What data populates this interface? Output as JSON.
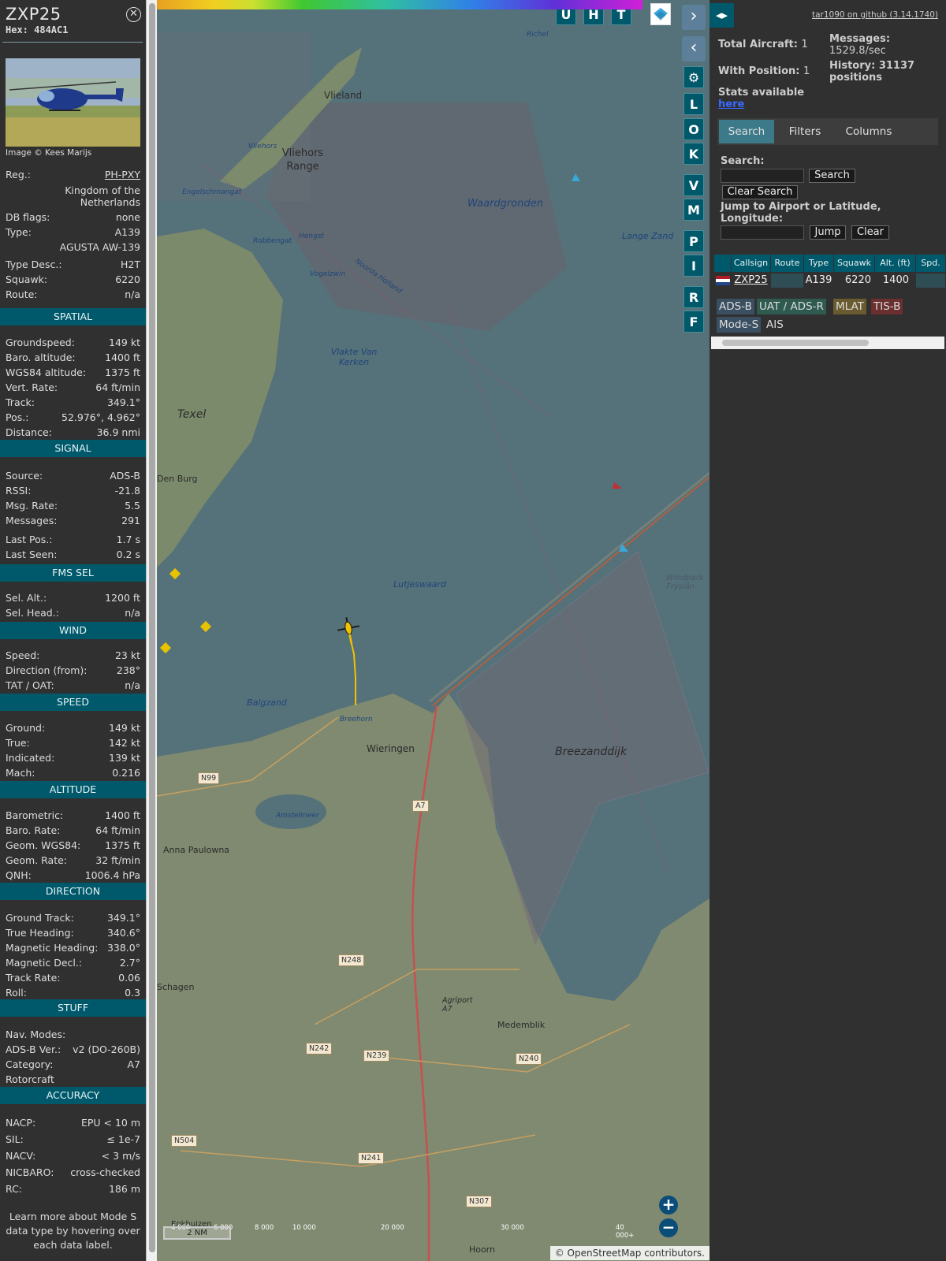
{
  "aircraft": {
    "callsign": "ZXP25",
    "hex": "Hex: 484AC1",
    "photo_credit": "Image © Kees Marijs",
    "reg_label": "Reg.:",
    "reg": "PH-PXY",
    "country": "Kingdom of the Netherlands",
    "dbflags_label": "DB flags:",
    "dbflags": "none",
    "type_label": "Type:",
    "type": "A139",
    "type_name": "AGUSTA AW-139",
    "typedesc_label": "Type Desc.:",
    "typedesc": "H2T",
    "squawk_label": "Squawk:",
    "squawk": "6220",
    "route_label": "Route:",
    "route": "n/a"
  },
  "spatial": {
    "title": "SPATIAL",
    "rows": [
      [
        "Groundspeed:",
        "149 kt"
      ],
      [
        "Baro. altitude:",
        "1400 ft"
      ],
      [
        "WGS84 altitude:",
        "1375 ft"
      ],
      [
        "Vert. Rate:",
        "64 ft/min"
      ],
      [
        "Track:",
        "349.1°"
      ],
      [
        "Pos.:",
        "52.976°, 4.962°"
      ],
      [
        "Distance:",
        "36.9 nmi"
      ]
    ]
  },
  "signal": {
    "title": "SIGNAL",
    "rows": [
      [
        "Source:",
        "ADS-B"
      ],
      [
        "RSSI:",
        "-21.8"
      ],
      [
        "Msg. Rate:",
        "5.5"
      ],
      [
        "Messages:",
        "291"
      ],
      [
        "Last Pos.:",
        "1.7 s"
      ],
      [
        "Last Seen:",
        "0.2 s"
      ]
    ]
  },
  "fms": {
    "title": "FMS SEL",
    "rows": [
      [
        "Sel. Alt.:",
        "1200 ft"
      ],
      [
        "Sel. Head.:",
        "n/a"
      ]
    ]
  },
  "wind": {
    "title": "WIND",
    "rows": [
      [
        "Speed:",
        "23 kt"
      ],
      [
        "Direction (from):",
        "238°"
      ],
      [
        "TAT / OAT:",
        "n/a"
      ]
    ]
  },
  "speed": {
    "title": "SPEED",
    "rows": [
      [
        "Ground:",
        "149 kt"
      ],
      [
        "True:",
        "142 kt"
      ],
      [
        "Indicated:",
        "139 kt"
      ],
      [
        "Mach:",
        "0.216"
      ]
    ]
  },
  "altitude": {
    "title": "ALTITUDE",
    "rows": [
      [
        "Barometric:",
        "1400 ft"
      ],
      [
        "Baro. Rate:",
        "64 ft/min"
      ],
      [
        "Geom. WGS84:",
        "1375 ft"
      ],
      [
        "Geom. Rate:",
        "32 ft/min"
      ],
      [
        "QNH:",
        "1006.4 hPa"
      ]
    ]
  },
  "direction": {
    "title": "DIRECTION",
    "rows": [
      [
        "Ground Track:",
        "349.1°"
      ],
      [
        "True Heading:",
        "340.6°"
      ],
      [
        "Magnetic Heading:",
        "338.0°"
      ],
      [
        "Magnetic Decl.:",
        "2.7°"
      ],
      [
        "Track Rate:",
        "0.06"
      ],
      [
        "Roll:",
        "0.3"
      ]
    ]
  },
  "stuff": {
    "title": "STUFF",
    "rows": [
      [
        "Nav. Modes:",
        ""
      ],
      [
        "ADS-B Ver.:",
        "v2 (DO-260B)"
      ],
      [
        "Category:",
        "A7"
      ],
      [
        "Rotorcraft",
        ""
      ]
    ]
  },
  "accuracy": {
    "title": "ACCURACY",
    "rows": [
      [
        "NACP:",
        "EPU < 10 m"
      ],
      [
        "SIL:",
        "≤ 1e-7"
      ],
      [
        "NACV:",
        "< 3 m/s"
      ],
      [
        "NICBARO:",
        "cross-checked"
      ],
      [
        "RC:",
        "186 m"
      ]
    ]
  },
  "learn_more": "Learn more about Mode S data type by hovering over each data label.",
  "map": {
    "top_buttons": [
      "U",
      "H",
      "T"
    ],
    "side_buttons": [
      "L",
      "O",
      "K",
      "V",
      "M",
      "P",
      "I",
      "R",
      "F"
    ],
    "labels_water": [
      "Waardgronden",
      "Lange Zand",
      "Vlakte Van Kerken",
      "Lutjeswaard",
      "Balgzand",
      "Breehorn",
      "Noorda Holland",
      "Vogelzwin",
      "Hengst",
      "Robbengat",
      "Engelschmangat",
      "Vliehors",
      "Richel",
      "Amstelmeer"
    ],
    "labels_land": [
      "Vlieland",
      "Vliehors Range",
      "Texel",
      "Wieringen",
      "Breezanddijk",
      "Den Burg",
      "Anna Paulowna",
      "Schagen",
      "Medemblik",
      "Agriport A7",
      "Hoorn",
      "Enkhuizen",
      "Windpark Fryslân"
    ],
    "road_shields": [
      "N99",
      "A7",
      "N248",
      "N242",
      "N239",
      "N240",
      "N504",
      "N241",
      "N307"
    ],
    "altitude_ticks": [
      "4 000",
      "6 000",
      "8 000",
      "10 000",
      "20 000",
      "30 000",
      "40 000+"
    ],
    "scale": "2 NM",
    "attribution": "© OpenStreetMap contributors."
  },
  "right": {
    "github": "tar1090 on github (3.14.1740)",
    "total_label": "Total Aircraft:",
    "total": "1",
    "withpos_label": "With Position:",
    "withpos": "1",
    "messages_label": "Messages:",
    "messages": "1529.8/sec",
    "history_label": "History: 31137 positions",
    "stats_label": "Stats available",
    "stats_link": "here",
    "tabs": [
      "Search",
      "Filters",
      "Columns"
    ],
    "search_label": "Search:",
    "search_btn": "Search",
    "clear_search": "Clear Search",
    "jump_label": "Jump to Airport or Latitude, Longitude:",
    "jump_btn": "Jump",
    "clear_btn": "Clear",
    "columns": [
      "Callsign",
      "Route",
      "Type",
      "Squawk",
      "Alt. (ft)",
      "Spd."
    ],
    "row": {
      "callsign": "ZXP25",
      "route": "",
      "type": "A139",
      "squawk": "6220",
      "alt": "1400"
    },
    "legend": [
      "ADS-B",
      "UAT / ADS-R",
      "MLAT",
      "TIS-B",
      "Mode-S",
      "AIS"
    ]
  },
  "colors": {
    "accent": "#00596b",
    "panel": "#303030",
    "adsb": "#3b4f62",
    "uat": "#2f5a4f",
    "mlat": "#6a5a2f",
    "tisb": "#6b2f2f",
    "modes": "#3b4f62"
  }
}
